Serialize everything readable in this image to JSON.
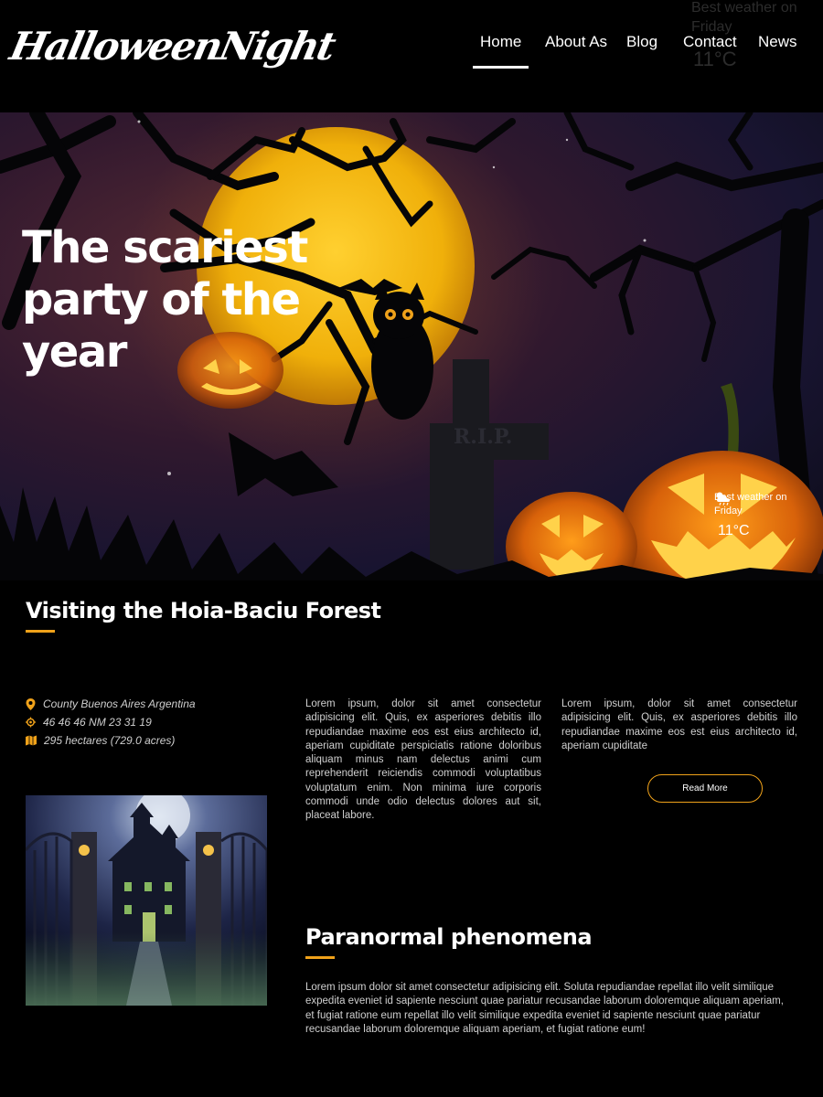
{
  "header": {
    "logo_text": "HalloweenNight",
    "nav": [
      {
        "label": "Home",
        "active": true
      },
      {
        "label": "About As",
        "active": false
      },
      {
        "label": "Blog",
        "active": false
      },
      {
        "label": "Contact",
        "active": false
      },
      {
        "label": "News",
        "active": false
      }
    ],
    "ghost_weather_label": "Best weather on Friday",
    "ghost_weather_temp": "11°C"
  },
  "hero": {
    "title": "The scariest party of the year",
    "tombstone_text": "R.I.P.",
    "weather_label": "Best weather on Friday",
    "weather_temp": "11°C",
    "weather_icon": "cloud-sun-rain-icon"
  },
  "visiting": {
    "title": "Visiting the Hoia-Baciu Forest",
    "info": [
      {
        "icon": "map-pin-icon",
        "text": "County Buenos Aires Argentina"
      },
      {
        "icon": "target-icon",
        "text": "46 46 46 NM 23 31 19"
      },
      {
        "icon": "map-icon",
        "text": "295 hectares (729.0 acres)"
      }
    ],
    "para1": "Lorem ipsum, dolor sit amet consectetur adipisicing elit. Quis, ex asperiores debitis illo repudiandae maxime eos est eius architecto id, aperiam cupiditate perspiciatis ratione doloribus aliquam minus nam delectus animi cum reprehenderit reiciendis commodi voluptatibus voluptatum enim. Non minima iure corporis commodi unde odio delectus dolores aut sit, placeat labore.",
    "para2": "Lorem ipsum, dolor sit amet consectetur adipisicing elit. Quis, ex asperiores debitis illo repudiandae maxime eos est eius architecto id, aperiam cupiditate",
    "read_more": "Read More"
  },
  "paranormal": {
    "title": "Paranormal phenomena",
    "text": "Lorem ipsum dolor sit amet consectetur adipisicing elit. Soluta repudiandae repellat illo velit similique expedita eveniet id sapiente nesciunt quae pariatur recusandae laborum doloremque aliquam aperiam, et fugiat ratione eum repellat illo velit similique expedita eveniet id sapiente nesciunt quae pariatur recusandae laborum doloremque aliquam aperiam, et fugiat ratione eum!"
  },
  "colors": {
    "accent": "#f0a21a",
    "background": "#000000",
    "moon": "#f2b50c",
    "text": "#ffffff"
  }
}
